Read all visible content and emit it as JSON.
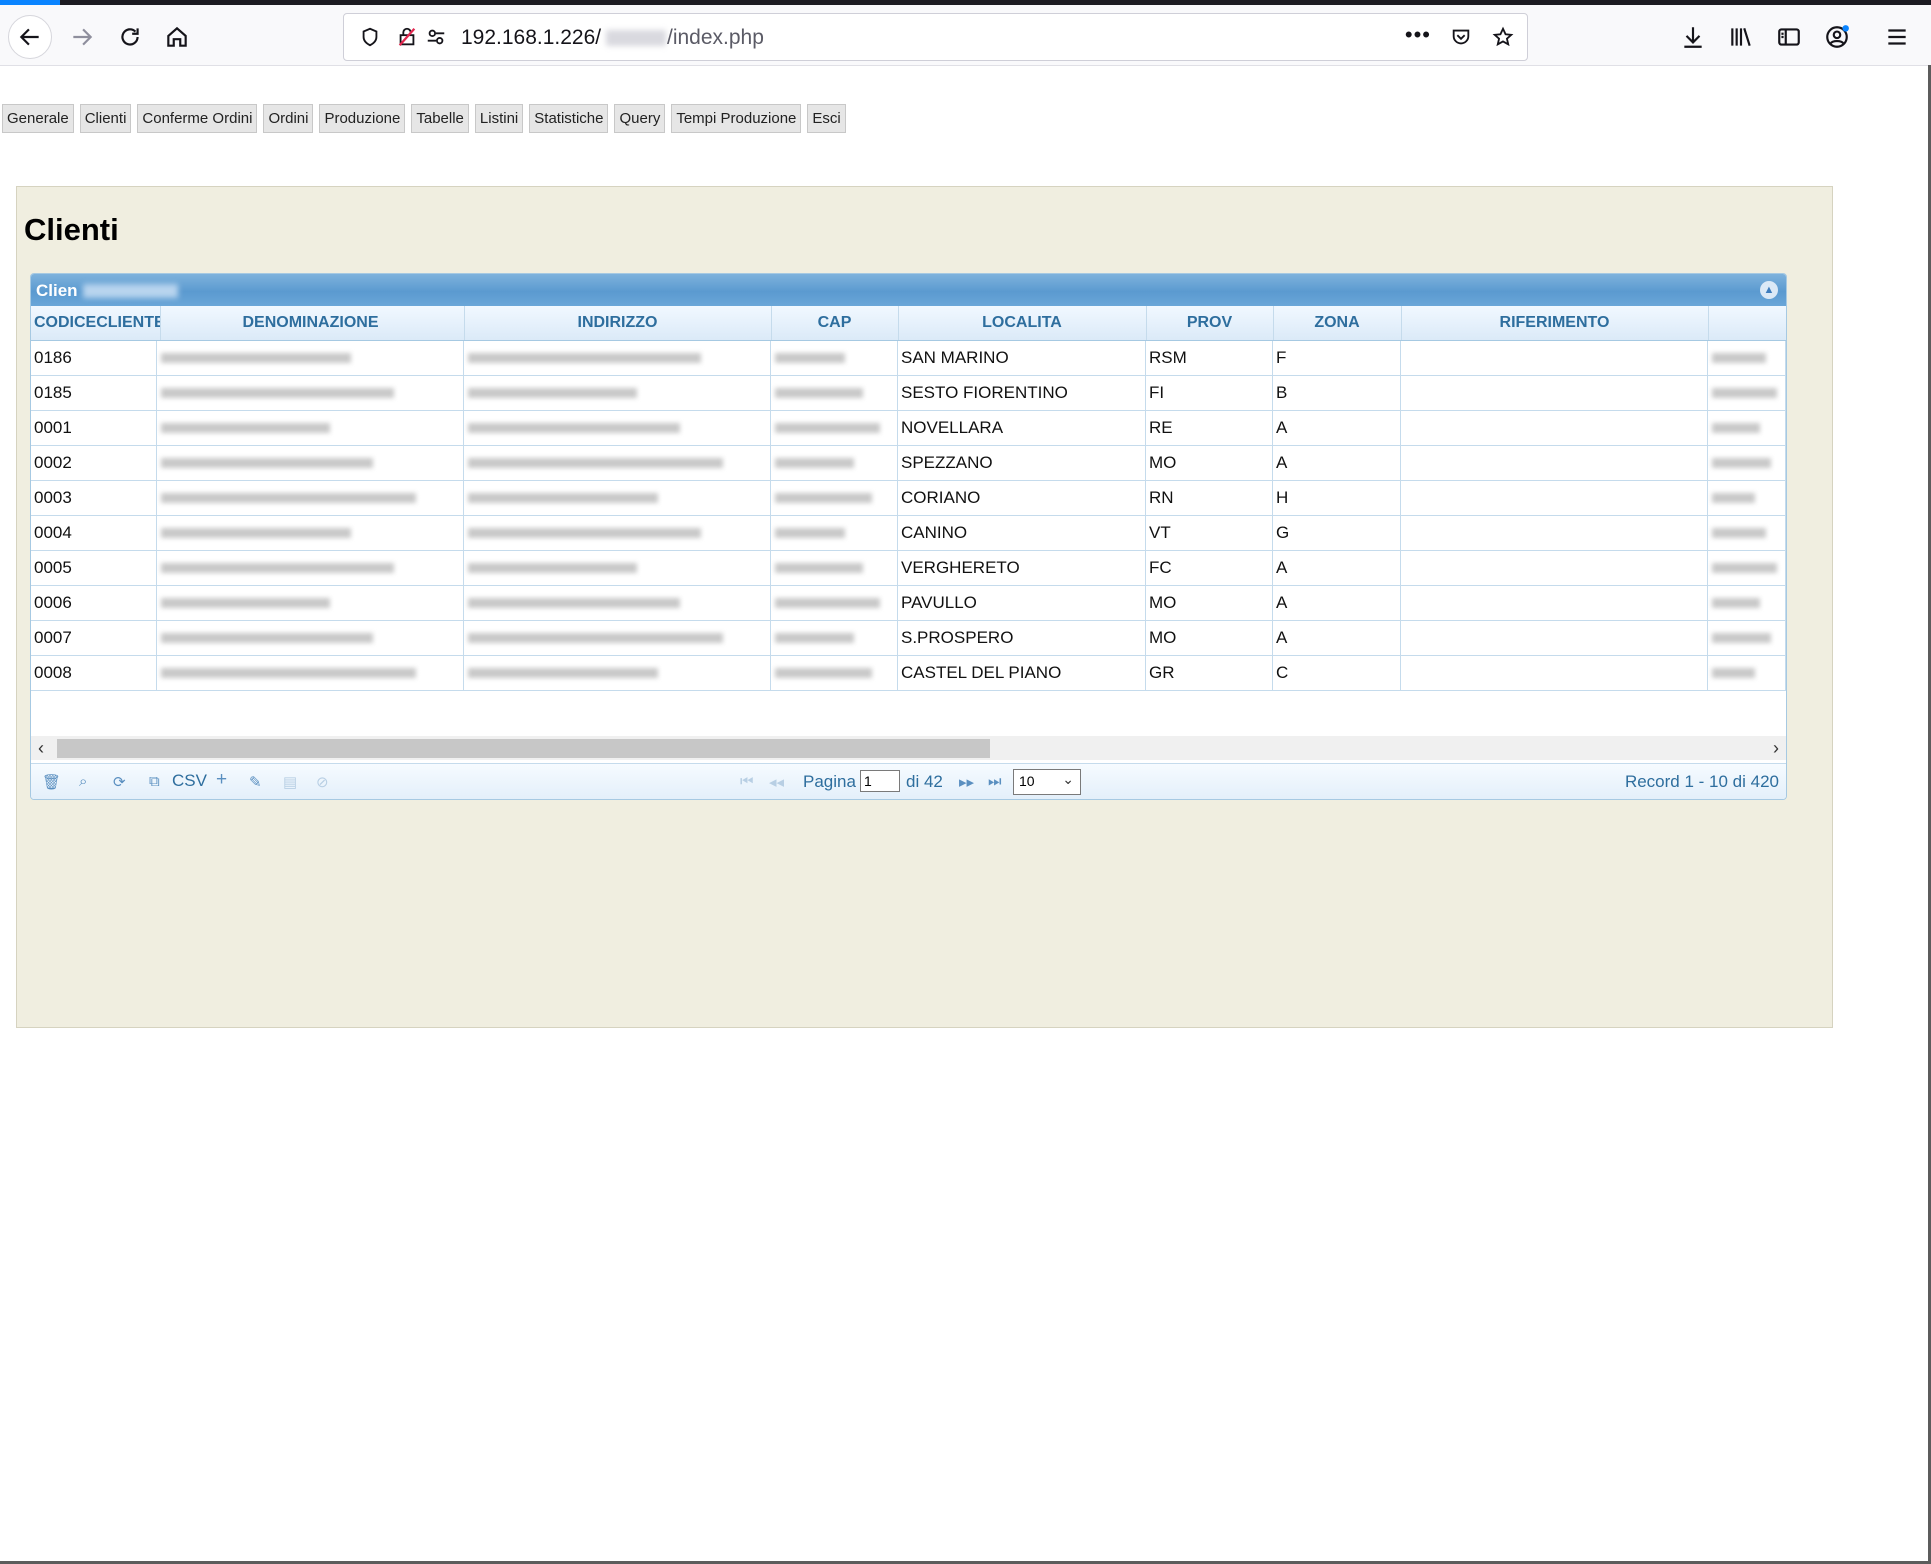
{
  "browser": {
    "url_host": "192.168.1.226/",
    "url_path": "/index.php"
  },
  "menu": [
    "Generale",
    "Clienti",
    "Conferme Ordini",
    "Ordini",
    "Produzione",
    "Tabelle",
    "Listini",
    "Statistiche",
    "Query",
    "Tempi Produzione",
    "Esci"
  ],
  "page_title": "Clienti",
  "grid": {
    "caption": "Clien",
    "columns": [
      "CODICECLIENTE",
      "DENOMINAZIONE",
      "INDIRIZZO",
      "CAP",
      "LOCALITA",
      "PROV",
      "ZONA",
      "RIFERIMENTO",
      ""
    ],
    "rows": [
      {
        "cod": "0186",
        "loc": "SAN MARINO",
        "prov": "RSM",
        "zona": "F"
      },
      {
        "cod": "0185",
        "loc": "SESTO FIORENTINO",
        "prov": "FI",
        "zona": "B"
      },
      {
        "cod": "0001",
        "loc": "NOVELLARA",
        "prov": "RE",
        "zona": "A"
      },
      {
        "cod": "0002",
        "loc": "SPEZZANO",
        "prov": "MO",
        "zona": "A"
      },
      {
        "cod": "0003",
        "loc": "CORIANO",
        "prov": "RN",
        "zona": "H"
      },
      {
        "cod": "0004",
        "loc": "CANINO",
        "prov": "VT",
        "zona": "G"
      },
      {
        "cod": "0005",
        "loc": "VERGHERETO",
        "prov": "FC",
        "zona": "A"
      },
      {
        "cod": "0006",
        "loc": "PAVULLO",
        "prov": "MO",
        "zona": "A"
      },
      {
        "cod": "0007",
        "loc": "S.PROSPERO",
        "prov": "MO",
        "zona": "A"
      },
      {
        "cod": "0008",
        "loc": "CASTEL DEL PIANO",
        "prov": "GR",
        "zona": "C"
      }
    ]
  },
  "pager": {
    "csv_label": "CSV",
    "page_label": "Pagina",
    "page_value": "1",
    "of_label": "di 42",
    "rows_per_page": "10",
    "record_info": "Record 1 - 10 di 420"
  },
  "colors": {
    "accent": "#2e6e9e",
    "panel": "#f0eee0",
    "header": "#5b9ad0"
  }
}
